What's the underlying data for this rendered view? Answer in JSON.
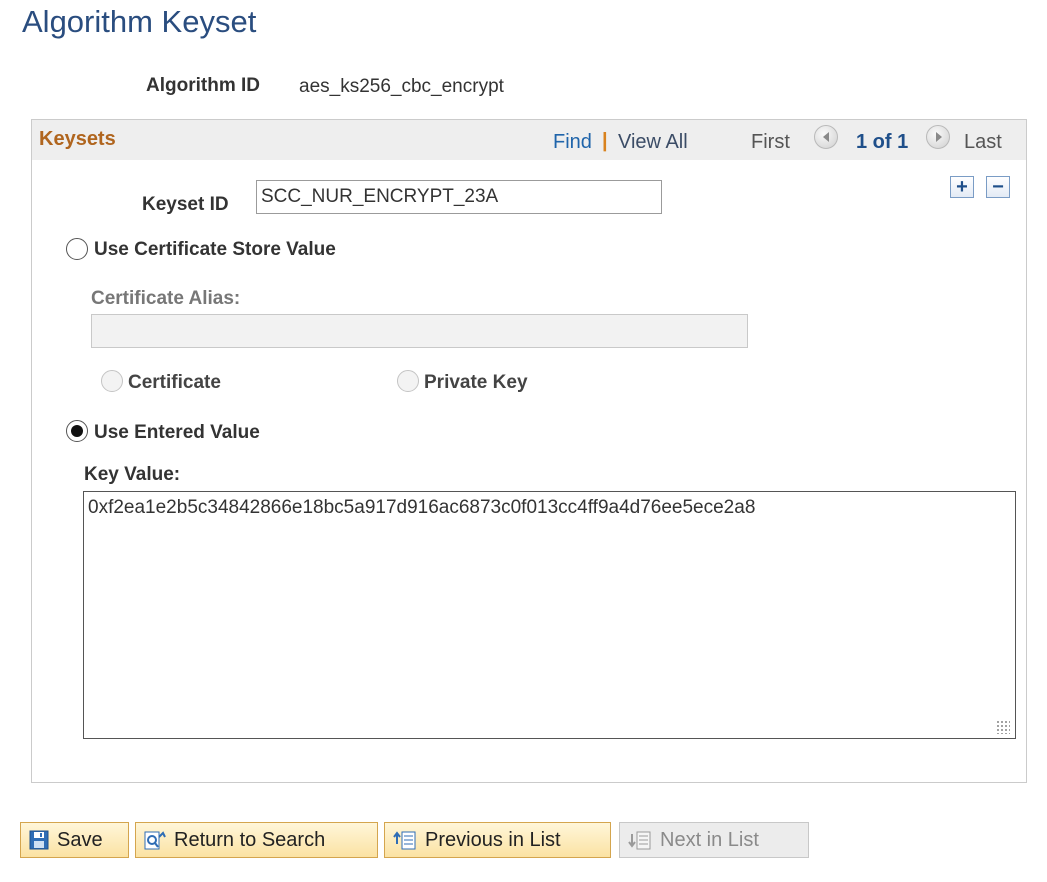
{
  "page": {
    "title": "Algorithm Keyset"
  },
  "algorithm": {
    "label": "Algorithm ID",
    "value": "aes_ks256_cbc_encrypt"
  },
  "keysets": {
    "title": "Keysets",
    "nav": {
      "find": "Find",
      "separator": "|",
      "view_all": "View All",
      "first": "First",
      "count": "1 of 1",
      "last": "Last"
    },
    "add_symbol": "+",
    "delete_symbol": "−",
    "keyset_id_label": "Keyset ID",
    "keyset_id_value": "SCC_NUR_ENCRYPT_23A",
    "use_cert_store_label": "Use Certificate Store Value",
    "cert_alias_label": "Certificate Alias:",
    "cert_alias_value": "",
    "certificate_label": "Certificate",
    "private_key_label": "Private Key",
    "use_entered_label": "Use Entered Value",
    "key_value_label": "Key Value:",
    "key_value": "0xf2ea1e2b5c34842866e18bc5a917d916ac6873c0f013cc4ff9a4d76ee5ece2a8",
    "selected_source": "Use Entered Value"
  },
  "buttons": {
    "save": "Save",
    "return_to_search": "Return to Search",
    "previous_in_list": "Previous in List",
    "next_in_list": "Next in List"
  },
  "icons": {
    "save": "save-icon",
    "return": "return-to-search-icon",
    "previous": "previous-in-list-icon",
    "next": "next-in-list-icon",
    "prev_nav": "prev-arrow-icon",
    "next_nav": "next-arrow-icon"
  },
  "colors": {
    "title": "#2a4d7f",
    "section_title": "#b0651e",
    "link": "#1f64aa",
    "button_bg": "#fbe2a3"
  }
}
